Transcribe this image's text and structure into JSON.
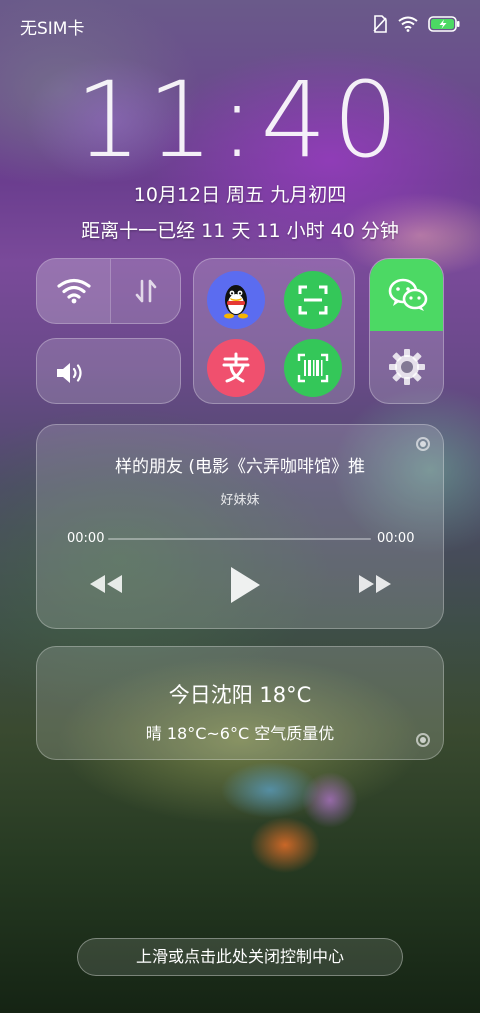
{
  "status_bar": {
    "carrier": "无SIM卡",
    "icons": [
      "sim-off-icon",
      "wifi-icon",
      "battery-charging-icon"
    ],
    "battery_color": "#4cd964"
  },
  "lockscreen": {
    "time": "11:40",
    "date": "10月12日 周五 九月初四",
    "countdown": "距离十一已经 11 天 11 小时 40 分钟"
  },
  "control_center": {
    "toggles": [
      "wifi-icon",
      "mobile-data-icon",
      "volume-icon"
    ],
    "shortcuts": [
      {
        "name": "qq-icon",
        "color": "#5b6cf0"
      },
      {
        "name": "scan-icon",
        "color": "#34c759"
      },
      {
        "name": "alipay-icon",
        "color": "#f0506e"
      },
      {
        "name": "barcode-pay-icon",
        "color": "#34c759"
      }
    ],
    "wechat_color": "#4cd964",
    "settings_icon": "gear-icon"
  },
  "media": {
    "title": "样的朋友 (电影《六弄咖啡馆》推",
    "artist": "好妹妹",
    "elapsed": "00:00",
    "duration": "00:00",
    "progress": 0
  },
  "weather": {
    "title": "今日沈阳 18°C",
    "detail": "晴 18°C~6°C 空气质量优"
  },
  "hint": "上滑或点击此处关闭控制中心"
}
